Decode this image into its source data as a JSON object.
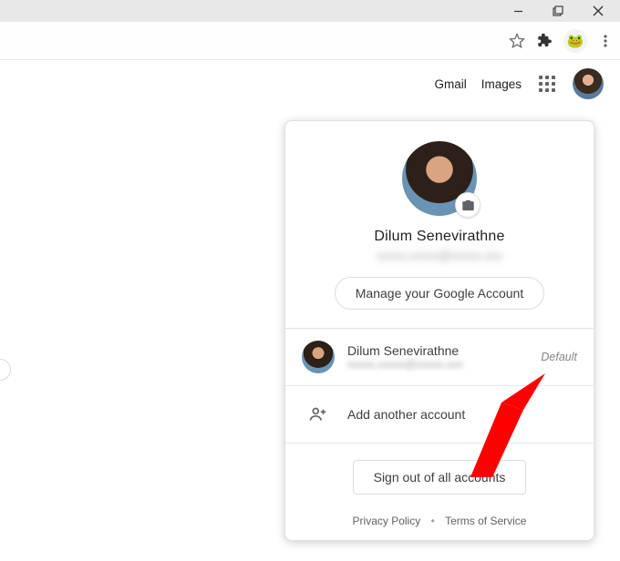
{
  "header": {
    "gmail": "Gmail",
    "images": "Images"
  },
  "profile": {
    "name": "Dilum Senevirathne",
    "email": "xxxxx.xxxxx@xxxxx.xxx",
    "manage_label": "Manage your Google Account"
  },
  "accounts": [
    {
      "name": "Dilum Senevirathne",
      "email": "xxxxx.xxxxx@xxxxx.xxx",
      "tag": "Default"
    }
  ],
  "add_account_label": "Add another account",
  "signout_label": "Sign out of all accounts",
  "footer": {
    "privacy": "Privacy Policy",
    "terms": "Terms of Service"
  }
}
